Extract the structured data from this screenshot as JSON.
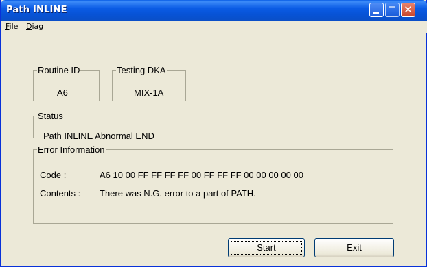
{
  "window": {
    "title": "Path INLINE"
  },
  "menu": {
    "file": {
      "key": "F",
      "rest": "ile"
    },
    "diag": {
      "key": "D",
      "rest": "iag"
    }
  },
  "routine": {
    "label": "Routine ID",
    "value": "A6"
  },
  "testing": {
    "label": "Testing DKA",
    "value": "MIX-1A"
  },
  "status": {
    "label": "Status",
    "value": "Path INLINE Abnormal END"
  },
  "error": {
    "label": "Error Information",
    "code_label": "Code :",
    "code_value": "A6 10 00 FF FF FF FF 00 FF FF FF 00 00 00 00 00",
    "contents_label": "Contents :",
    "contents_value": "There was N.G. error to a part of PATH."
  },
  "buttons": {
    "start": "Start",
    "exit": "Exit"
  },
  "icons": {
    "minimize": "minimize-icon",
    "maximize": "maximize-icon",
    "close": "close-icon"
  }
}
